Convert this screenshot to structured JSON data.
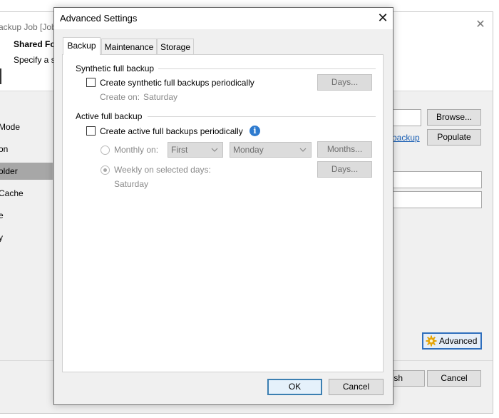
{
  "background_window": {
    "title": "ackup Job [Job",
    "heading": "Shared Fo",
    "subheading": "Specify a s",
    "nav_items": [
      "Mode",
      "on",
      "older",
      "Cache",
      "e",
      "y"
    ],
    "selected_nav_index": 2,
    "browse_label": "Browse...",
    "backup_link": "backup",
    "populate_label": "Populate",
    "advanced_label": "Advanced",
    "finish_label": "ish",
    "cancel_label": "Cancel"
  },
  "dialog": {
    "title": "Advanced Settings",
    "tabs": [
      "Backup",
      "Maintenance",
      "Storage"
    ],
    "active_tab": "Backup",
    "synthetic": {
      "group_title": "Synthetic full backup",
      "checkbox_label": "Create synthetic full backups periodically",
      "checked": false,
      "create_on_label": "Create on:",
      "create_on_value": "Saturday",
      "days_button": "Days..."
    },
    "active": {
      "group_title": "Active full backup",
      "checkbox_label": "Create active full backups periodically",
      "checked": false,
      "monthly_label": "Monthly on:",
      "monthly_week": "First",
      "monthly_day": "Monday",
      "months_button": "Months...",
      "weekly_label": "Weekly on selected days:",
      "weekly_selected": true,
      "weekly_days": "Saturday",
      "days_button": "Days..."
    },
    "ok_label": "OK",
    "cancel_label": "Cancel"
  },
  "colors": {
    "accent": "#3c7fb1",
    "info_icon": "#2e7bcf",
    "link": "#1a5fb4"
  }
}
